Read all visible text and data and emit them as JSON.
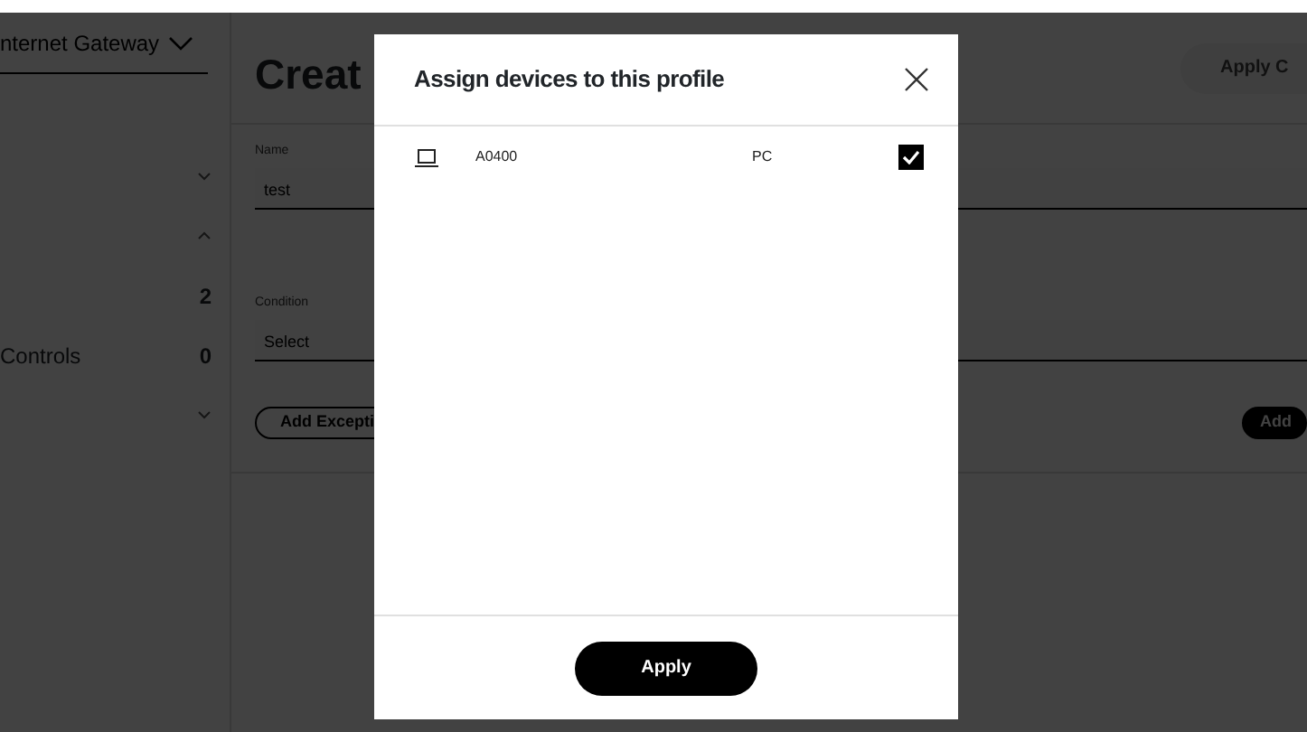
{
  "sidebar": {
    "gateway_select": "nternet Gateway",
    "items": [
      {
        "kind": "chevron",
        "expanded": false
      },
      {
        "kind": "chevron",
        "expanded": true
      },
      {
        "kind": "count",
        "count": "2"
      },
      {
        "kind": "count",
        "label": "Controls",
        "count": "0"
      },
      {
        "kind": "chevron",
        "expanded": false
      }
    ]
  },
  "page": {
    "title": "Creat",
    "apply_button": "Apply C",
    "fields": [
      {
        "label": "Name",
        "value": "test"
      },
      {
        "label": "Condition",
        "value": "Select"
      }
    ],
    "add_exception_button": "Add Excepti",
    "add_button": "Add"
  },
  "modal": {
    "title": "Assign devices to this profile",
    "devices": [
      {
        "name": "A0400",
        "type": "PC",
        "checked": true
      }
    ],
    "apply_button": "Apply"
  }
}
